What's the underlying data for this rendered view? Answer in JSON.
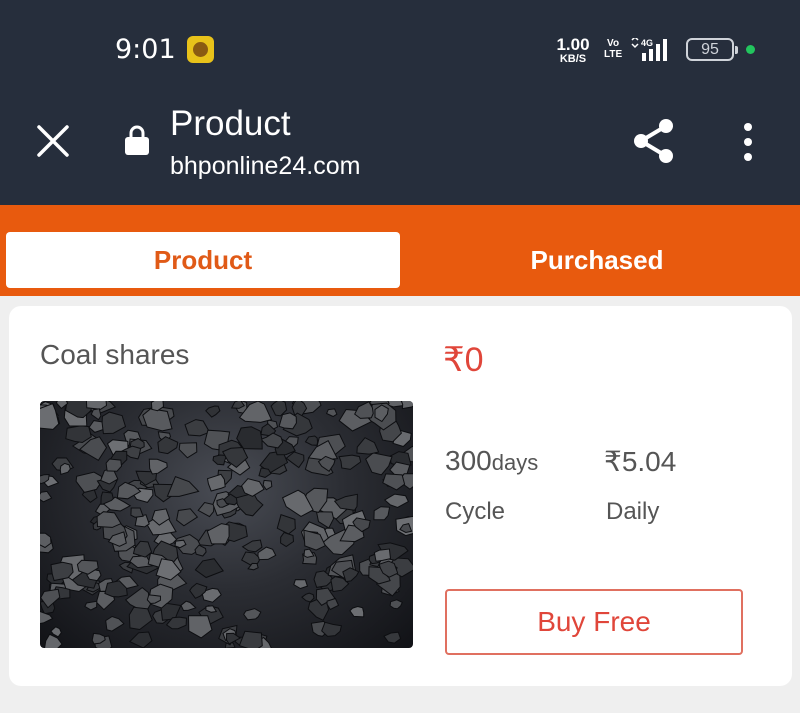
{
  "status_bar": {
    "time": "9:01",
    "net_speed_value": "1.00",
    "net_speed_unit": "KB/S",
    "volte_top": "Vo",
    "volte_bottom": "LTE",
    "network": "4G",
    "battery": "95",
    "notif_icon": "app-notification-icon"
  },
  "browser_bar": {
    "close_icon": "close-icon",
    "lock_icon": "lock-icon",
    "title": "Product",
    "url": "bhponline24.com",
    "share_icon": "share-icon",
    "more_icon": "more-vertical-icon"
  },
  "tabs": [
    {
      "label": "Product",
      "active": true
    },
    {
      "label": "Purchased",
      "active": false
    }
  ],
  "product": {
    "name": "Coal shares",
    "price": "₹0",
    "cycle_value": "300",
    "cycle_unit": "days",
    "cycle_label": "Cycle",
    "daily_value": "₹5.04",
    "daily_label": "Daily",
    "buy_label": "Buy Free"
  },
  "colors": {
    "header_bg": "#262e3c",
    "tabbar_bg": "#e85a0e",
    "accent_red": "#e0463a",
    "page_bg": "#efefef"
  }
}
